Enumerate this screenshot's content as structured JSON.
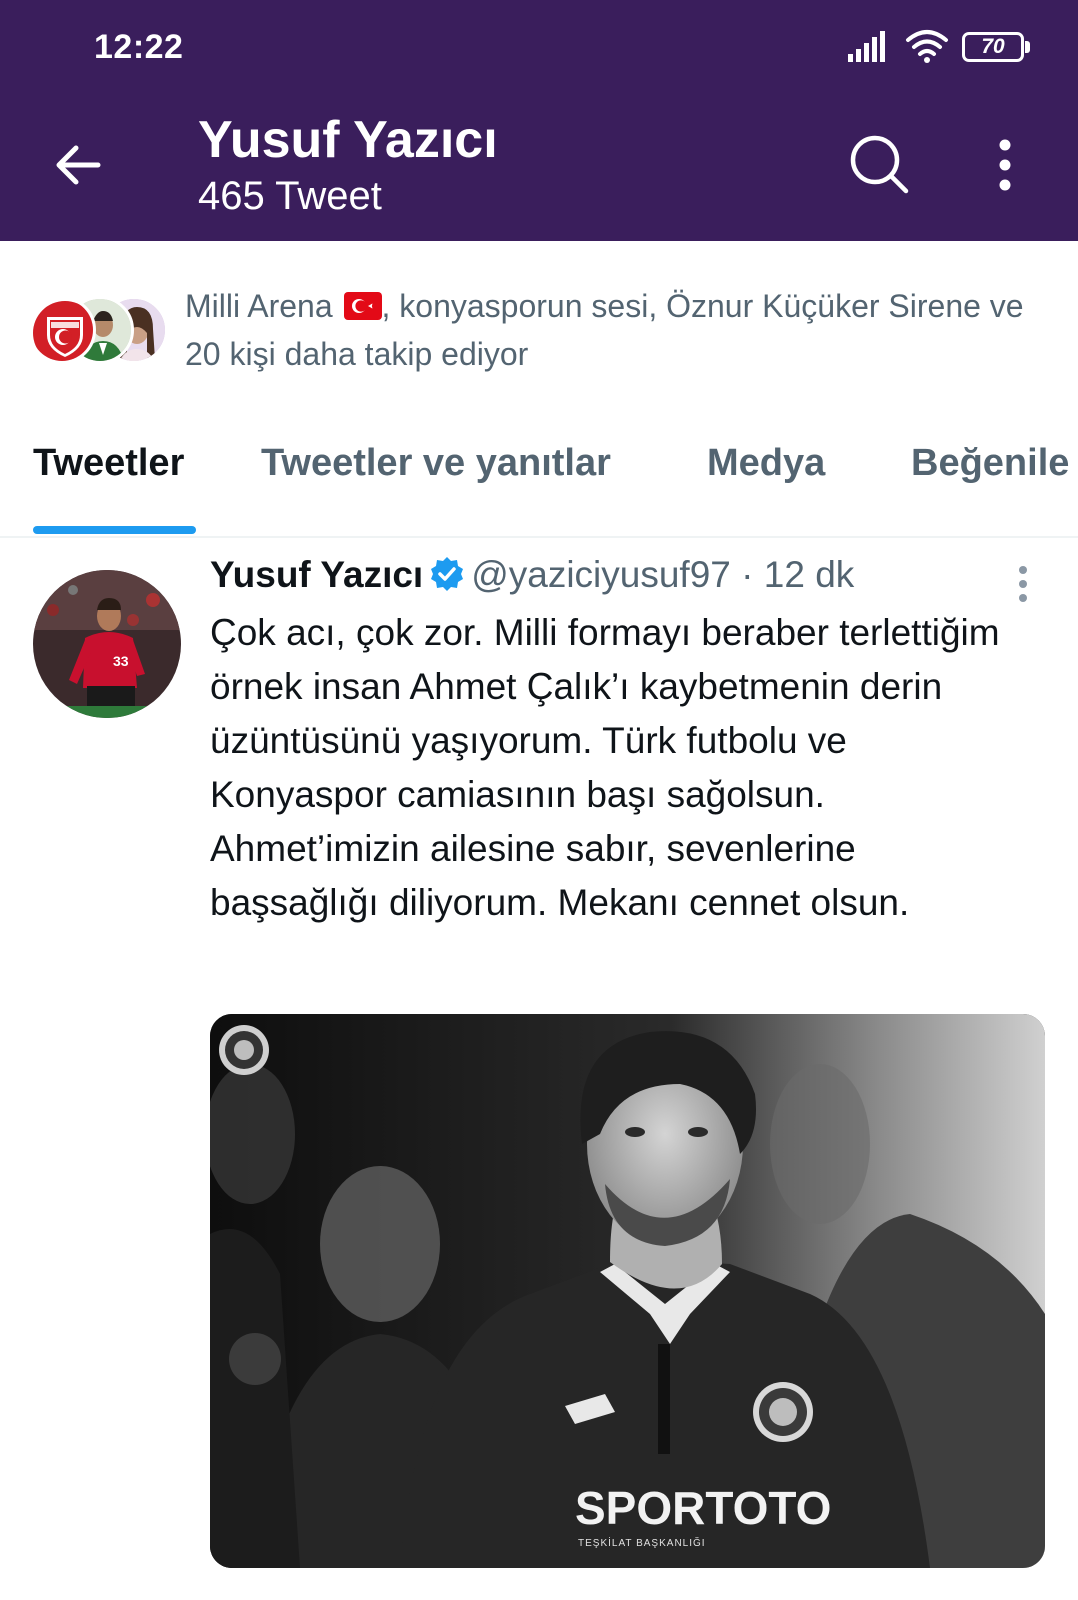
{
  "status_bar": {
    "time": "12:22",
    "battery": "70"
  },
  "header": {
    "title": "Yusuf Yazıcı",
    "subtitle": "465 Tweet"
  },
  "followed_by": {
    "text_before_flag": "Milli Arena ",
    "text_after_flag": ", konyasporun sesi, Öznur Küçüker Sirene ve 20 kişi daha takip ediyor"
  },
  "tabs": [
    {
      "label": "Tweetler",
      "active": true
    },
    {
      "label": "Tweetler ve yanıtlar",
      "active": false
    },
    {
      "label": "Medya",
      "active": false
    },
    {
      "label": "Beğenile",
      "active": false
    }
  ],
  "tweet": {
    "author_name": "Yusuf Yazıcı",
    "handle": "@yaziciyusuf97",
    "separator": " · ",
    "time_ago": "12 dk",
    "text": "Çok acı, çok zor. Milli formayı beraber terlettiğim örnek insan Ahmet Çalık’ı kaybetmenin derin üzüntüsünü yaşıyorum. Türk futbolu ve Konyaspor camiasının başı sağolsun. Ahmet’imizin ailesine sabır, sevenlerine başsağlığı diliyorum. Mekanı cennet olsun.",
    "media": {
      "sponsor_text": "SPORTOTO",
      "sponsor_sub": "TEŞKİLAT BAŞKANLIĞI"
    }
  },
  "colors": {
    "header_bg": "#3a1e5c",
    "accent": "#1d9bf0",
    "secondary_text": "#536471",
    "primary_text": "#0f1419"
  }
}
